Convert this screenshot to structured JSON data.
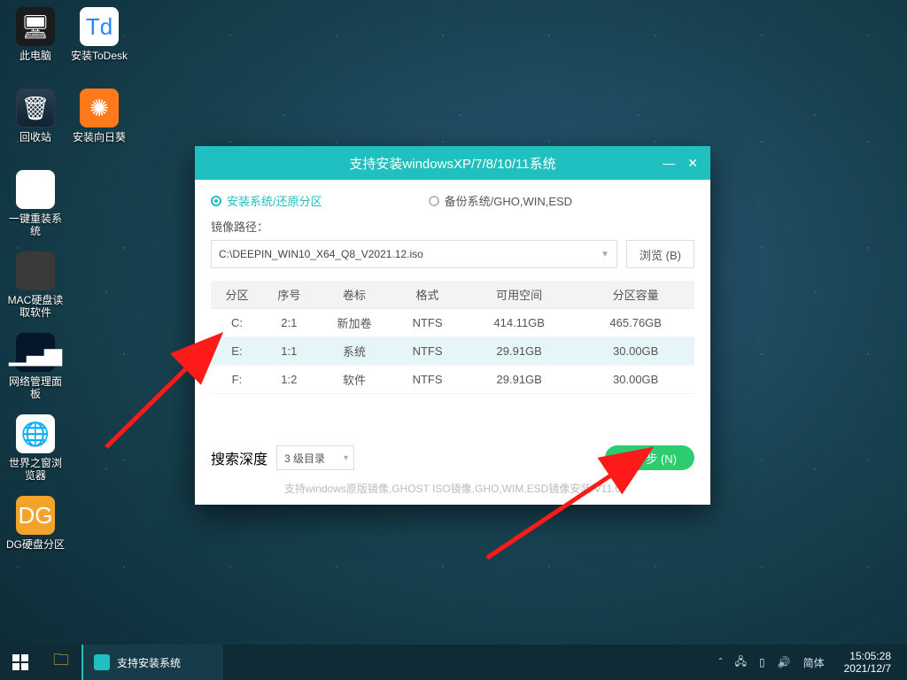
{
  "desktop_icons": [
    {
      "label": "此电脑",
      "glyph": "🖥",
      "cls": "g-pc"
    },
    {
      "label": "安装ToDesk",
      "glyph": "Td",
      "cls": "g-todesk"
    },
    {
      "label": "回收站",
      "glyph": "🗑",
      "cls": "g-bin"
    },
    {
      "label": "安装向日葵",
      "glyph": "✺",
      "cls": "g-sun"
    },
    {
      "label": "一键重装系统",
      "glyph": "↻",
      "cls": "g-reinst"
    },
    {
      "label": "",
      "glyph": "",
      "cls": ""
    },
    {
      "label": "MAC硬盘读取软件",
      "glyph": "",
      "cls": "g-mac"
    },
    {
      "label": "",
      "glyph": "",
      "cls": ""
    },
    {
      "label": "网络管理面板",
      "glyph": "▁▃▅",
      "cls": "g-net"
    },
    {
      "label": "",
      "glyph": "",
      "cls": ""
    },
    {
      "label": "世界之窗浏览器",
      "glyph": "🌐",
      "cls": "g-browser"
    },
    {
      "label": "",
      "glyph": "",
      "cls": ""
    },
    {
      "label": "DG硬盘分区",
      "glyph": "DG",
      "cls": "g-dg"
    }
  ],
  "window": {
    "title": "支持安装windowsXP/7/8/10/11系统",
    "tab_install": "安装系统/还原分区",
    "tab_backup": "备份系统/GHO,WIN,ESD",
    "path_label": "镜像路径：",
    "path_value": "C:\\DEEPIN_WIN10_X64_Q8_V2021.12.iso",
    "browse": "浏览 (B)",
    "columns": [
      "分区",
      "序号",
      "卷标",
      "格式",
      "可用空间",
      "分区容量"
    ],
    "rows": [
      {
        "part": "C:",
        "idx": "2:1",
        "vol": "新加卷",
        "fmt": "NTFS",
        "free": "414.11GB",
        "size": "465.76GB",
        "sel": false
      },
      {
        "part": "E:",
        "idx": "1:1",
        "vol": "系统",
        "fmt": "NTFS",
        "free": "29.91GB",
        "size": "30.00GB",
        "sel": true
      },
      {
        "part": "F:",
        "idx": "1:2",
        "vol": "软件",
        "fmt": "NTFS",
        "free": "29.91GB",
        "size": "30.00GB",
        "sel": false
      }
    ],
    "depth_label": "搜索深度",
    "depth_value": "3 级目录",
    "next": "下一步 (N)",
    "hint": "支持windows原版镜像,GHOST ISO镜像,GHO,WIM,ESD镜像安装  V11.0"
  },
  "taskbar": {
    "task_label": "支持安装系统",
    "ime": "简体",
    "time": "15:05:28",
    "date": "2021/12/7"
  }
}
